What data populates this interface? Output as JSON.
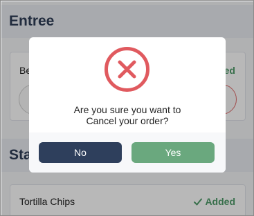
{
  "background": {
    "sections": [
      {
        "title": "Entree"
      },
      {
        "title": "Sta"
      }
    ],
    "items": [
      {
        "name": "Be",
        "status": "dded"
      },
      {
        "name": "Tortilla Chips",
        "status": "Added"
      }
    ]
  },
  "modal": {
    "icon": "cancel-x-circle-icon",
    "message_line1": "Are you sure you want to",
    "message_line2": "Cancel your order?",
    "no_label": "No",
    "yes_label": "Yes"
  },
  "colors": {
    "navy": "#2e3f5c",
    "green": "#6aa87e",
    "danger": "#e05a5f"
  }
}
